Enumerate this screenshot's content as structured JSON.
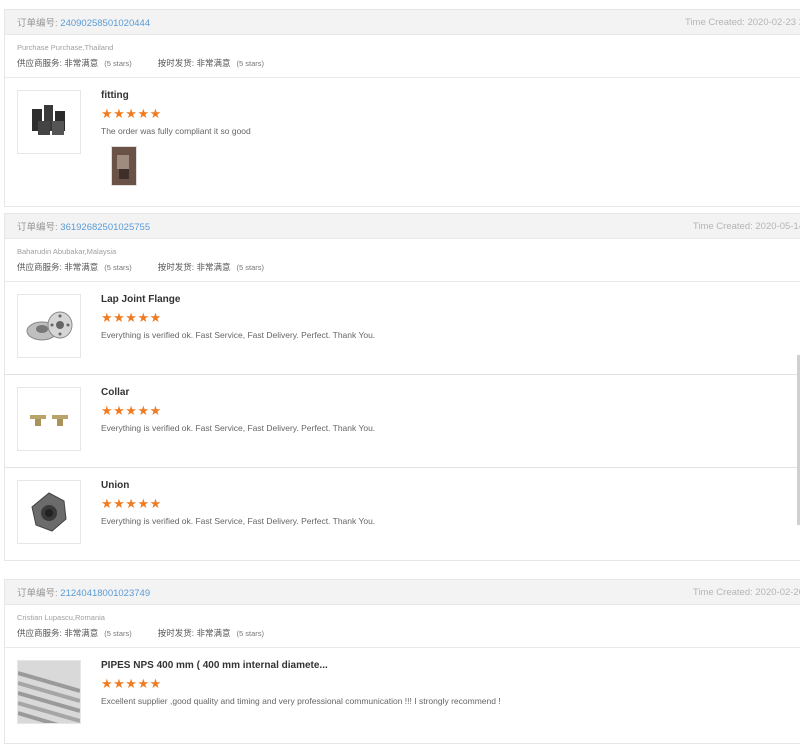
{
  "labels": {
    "order_no": "订单编号:",
    "supplier_service": "供应商服务:",
    "on_time": "按时发货:",
    "very_satisfied": "非常满意",
    "five_stars": "(5 stars)",
    "time_created": "Time Created:",
    "stars": "★★★★★"
  },
  "orders": [
    {
      "number": "240902585010204​44",
      "time": "2020-02-23 2",
      "buyer": "Purchase Purchase,Thailand",
      "items": [
        {
          "name": "fitting",
          "review": "The order was fully compliant it so good",
          "icon": "fitting-product-image"
        }
      ]
    },
    {
      "number": "36192682501025755",
      "time": "2020-05-14",
      "buyer": "Baharudin Abubakar,Malaysia",
      "items": [
        {
          "name": "Lap Joint Flange",
          "review": "Everything is verified ok. Fast Service, Fast Delivery. Perfect. Thank You.",
          "icon": "flange-product-image"
        },
        {
          "name": "Collar",
          "review": "Everything is verified ok. Fast Service, Fast Delivery. Perfect. Thank You.",
          "icon": "collar-product-image"
        },
        {
          "name": "Union",
          "review": "Everything is verified ok. Fast Service, Fast Delivery. Perfect. Thank You.",
          "icon": "union-product-image"
        }
      ]
    },
    {
      "number": "21240418001023749",
      "time": "2020-02-20",
      "buyer": "Cristian Lupascu,Romania",
      "items": [
        {
          "name": "PIPES NPS 400 mm ( 400 mm internal diamete...",
          "review": "Excellent supplier ,good quality and timing and very professional communication !!! I strongly recommend !",
          "icon": "pipes-product-image"
        }
      ]
    }
  ],
  "colors": {
    "accent_star": "#f07c22",
    "order_link": "#5a9bd6"
  }
}
